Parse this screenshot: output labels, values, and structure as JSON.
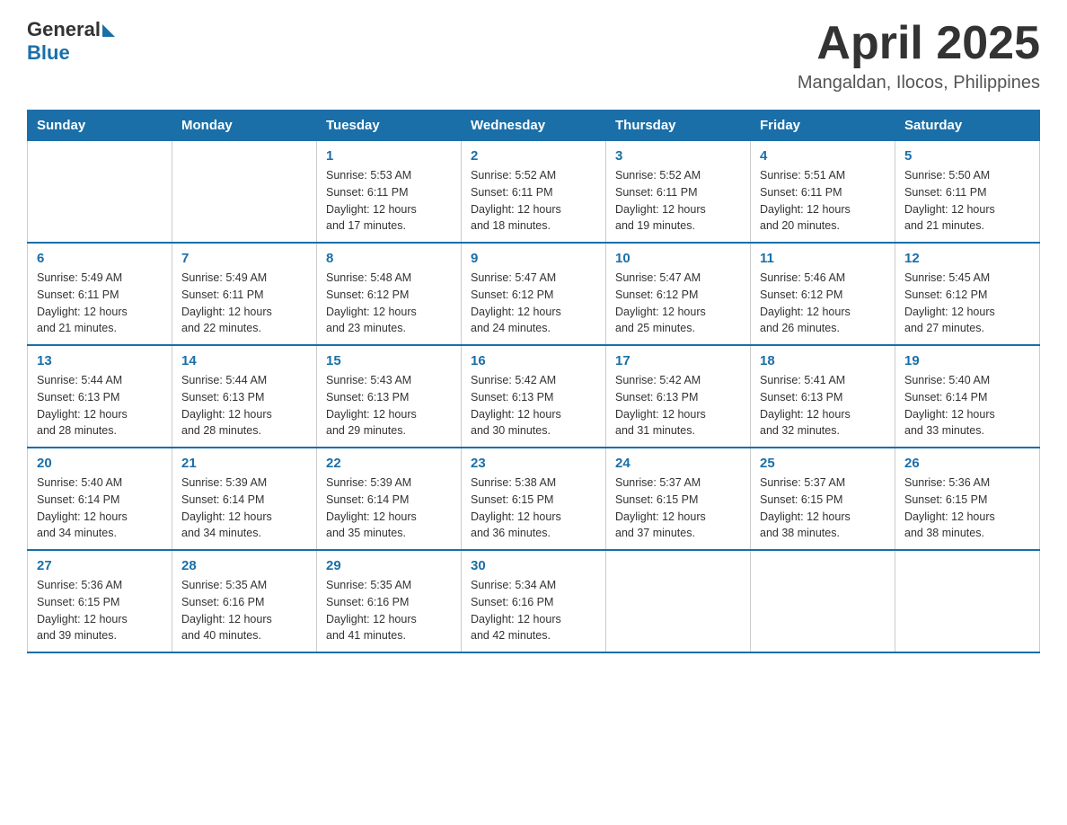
{
  "header": {
    "logo_general": "General",
    "logo_blue": "Blue",
    "month_title": "April 2025",
    "location": "Mangaldan, Ilocos, Philippines"
  },
  "weekdays": [
    "Sunday",
    "Monday",
    "Tuesday",
    "Wednesday",
    "Thursday",
    "Friday",
    "Saturday"
  ],
  "weeks": [
    [
      {
        "day": "",
        "info": ""
      },
      {
        "day": "",
        "info": ""
      },
      {
        "day": "1",
        "info": "Sunrise: 5:53 AM\nSunset: 6:11 PM\nDaylight: 12 hours\nand 17 minutes."
      },
      {
        "day": "2",
        "info": "Sunrise: 5:52 AM\nSunset: 6:11 PM\nDaylight: 12 hours\nand 18 minutes."
      },
      {
        "day": "3",
        "info": "Sunrise: 5:52 AM\nSunset: 6:11 PM\nDaylight: 12 hours\nand 19 minutes."
      },
      {
        "day": "4",
        "info": "Sunrise: 5:51 AM\nSunset: 6:11 PM\nDaylight: 12 hours\nand 20 minutes."
      },
      {
        "day": "5",
        "info": "Sunrise: 5:50 AM\nSunset: 6:11 PM\nDaylight: 12 hours\nand 21 minutes."
      }
    ],
    [
      {
        "day": "6",
        "info": "Sunrise: 5:49 AM\nSunset: 6:11 PM\nDaylight: 12 hours\nand 21 minutes."
      },
      {
        "day": "7",
        "info": "Sunrise: 5:49 AM\nSunset: 6:11 PM\nDaylight: 12 hours\nand 22 minutes."
      },
      {
        "day": "8",
        "info": "Sunrise: 5:48 AM\nSunset: 6:12 PM\nDaylight: 12 hours\nand 23 minutes."
      },
      {
        "day": "9",
        "info": "Sunrise: 5:47 AM\nSunset: 6:12 PM\nDaylight: 12 hours\nand 24 minutes."
      },
      {
        "day": "10",
        "info": "Sunrise: 5:47 AM\nSunset: 6:12 PM\nDaylight: 12 hours\nand 25 minutes."
      },
      {
        "day": "11",
        "info": "Sunrise: 5:46 AM\nSunset: 6:12 PM\nDaylight: 12 hours\nand 26 minutes."
      },
      {
        "day": "12",
        "info": "Sunrise: 5:45 AM\nSunset: 6:12 PM\nDaylight: 12 hours\nand 27 minutes."
      }
    ],
    [
      {
        "day": "13",
        "info": "Sunrise: 5:44 AM\nSunset: 6:13 PM\nDaylight: 12 hours\nand 28 minutes."
      },
      {
        "day": "14",
        "info": "Sunrise: 5:44 AM\nSunset: 6:13 PM\nDaylight: 12 hours\nand 28 minutes."
      },
      {
        "day": "15",
        "info": "Sunrise: 5:43 AM\nSunset: 6:13 PM\nDaylight: 12 hours\nand 29 minutes."
      },
      {
        "day": "16",
        "info": "Sunrise: 5:42 AM\nSunset: 6:13 PM\nDaylight: 12 hours\nand 30 minutes."
      },
      {
        "day": "17",
        "info": "Sunrise: 5:42 AM\nSunset: 6:13 PM\nDaylight: 12 hours\nand 31 minutes."
      },
      {
        "day": "18",
        "info": "Sunrise: 5:41 AM\nSunset: 6:13 PM\nDaylight: 12 hours\nand 32 minutes."
      },
      {
        "day": "19",
        "info": "Sunrise: 5:40 AM\nSunset: 6:14 PM\nDaylight: 12 hours\nand 33 minutes."
      }
    ],
    [
      {
        "day": "20",
        "info": "Sunrise: 5:40 AM\nSunset: 6:14 PM\nDaylight: 12 hours\nand 34 minutes."
      },
      {
        "day": "21",
        "info": "Sunrise: 5:39 AM\nSunset: 6:14 PM\nDaylight: 12 hours\nand 34 minutes."
      },
      {
        "day": "22",
        "info": "Sunrise: 5:39 AM\nSunset: 6:14 PM\nDaylight: 12 hours\nand 35 minutes."
      },
      {
        "day": "23",
        "info": "Sunrise: 5:38 AM\nSunset: 6:15 PM\nDaylight: 12 hours\nand 36 minutes."
      },
      {
        "day": "24",
        "info": "Sunrise: 5:37 AM\nSunset: 6:15 PM\nDaylight: 12 hours\nand 37 minutes."
      },
      {
        "day": "25",
        "info": "Sunrise: 5:37 AM\nSunset: 6:15 PM\nDaylight: 12 hours\nand 38 minutes."
      },
      {
        "day": "26",
        "info": "Sunrise: 5:36 AM\nSunset: 6:15 PM\nDaylight: 12 hours\nand 38 minutes."
      }
    ],
    [
      {
        "day": "27",
        "info": "Sunrise: 5:36 AM\nSunset: 6:15 PM\nDaylight: 12 hours\nand 39 minutes."
      },
      {
        "day": "28",
        "info": "Sunrise: 5:35 AM\nSunset: 6:16 PM\nDaylight: 12 hours\nand 40 minutes."
      },
      {
        "day": "29",
        "info": "Sunrise: 5:35 AM\nSunset: 6:16 PM\nDaylight: 12 hours\nand 41 minutes."
      },
      {
        "day": "30",
        "info": "Sunrise: 5:34 AM\nSunset: 6:16 PM\nDaylight: 12 hours\nand 42 minutes."
      },
      {
        "day": "",
        "info": ""
      },
      {
        "day": "",
        "info": ""
      },
      {
        "day": "",
        "info": ""
      }
    ]
  ]
}
